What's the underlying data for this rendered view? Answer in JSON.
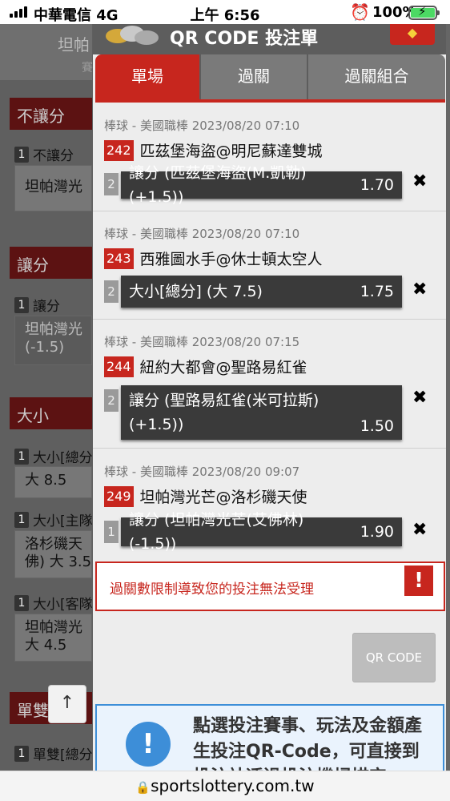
{
  "status": {
    "carrier": "中華電信  4G",
    "time": "上午 6:56",
    "battery": "100%"
  },
  "background": {
    "top_text": "坦帕",
    "top_sub": "賽",
    "sections": [
      {
        "title": "不讓分",
        "label": "不讓分",
        "idx": "1",
        "box": "坦帕灣光"
      },
      {
        "title": "讓分",
        "label": "讓分",
        "idx": "1",
        "box": "坦帕灣光\n(-1.5)"
      },
      {
        "title": "大小",
        "items": [
          {
            "idx": "1",
            "label": "大小[總分",
            "box": "大 8.5"
          },
          {
            "idx": "1",
            "label": "大小[主隊",
            "box": "洛杉磯天\n佛) 大 3.5"
          },
          {
            "idx": "1",
            "label": "大小[客隊",
            "box": "坦帕灣光\n大 4.5"
          }
        ]
      },
      {
        "title": "單雙",
        "label": "單雙[總分",
        "idx": "1"
      }
    ]
  },
  "modal": {
    "title": "QR CODE 投注單",
    "tabs": [
      "單場",
      "過關",
      "過關組合"
    ],
    "bets": [
      {
        "meta": "棒球 - 美國職棒 2023/08/20 07:10",
        "num": "242",
        "teams": "匹茲堡海盜@明尼蘇達雙城",
        "idx": "2",
        "pick": "讓分 (匹茲堡海盜(M.凱勒) (+1.5))",
        "odds": "1.70"
      },
      {
        "meta": "棒球 - 美國職棒 2023/08/20 07:10",
        "num": "243",
        "teams": "西雅圖水手@休士頓太空人",
        "idx": "2",
        "pick": "大小[總分] (大 7.5)",
        "odds": "1.75"
      },
      {
        "meta": "棒球 - 美國職棒 2023/08/20 07:15",
        "num": "244",
        "teams": "紐約大都會@聖路易紅雀",
        "idx": "2",
        "pick": "讓分 (聖路易紅雀(米可拉斯) (+1.5))",
        "odds": "1.50"
      },
      {
        "meta": "棒球 - 美國職棒 2023/08/20 09:07",
        "num": "249",
        "teams": "坦帕灣光芒@洛杉磯天使",
        "idx": "1",
        "pick": "讓分 (坦帕灣光芒(艾佛林) (-1.5))",
        "odds": "1.90"
      }
    ],
    "error": "過關數限制導致您的投注無法受理",
    "qr_button": "QR CODE",
    "info": "點選投注賽事、玩法及金額產生投注QR-Code，可直接到投注站透過投注機掃描完"
  },
  "url": "sportslottery.com.tw",
  "icons": {
    "remove": "close-x-icon",
    "error": "exclamation-icon",
    "info": "info-icon",
    "up": "arrow-up-icon",
    "lock": "lock-icon"
  },
  "colors": {
    "accent": "#c7261e",
    "info": "#3d8ed8"
  }
}
